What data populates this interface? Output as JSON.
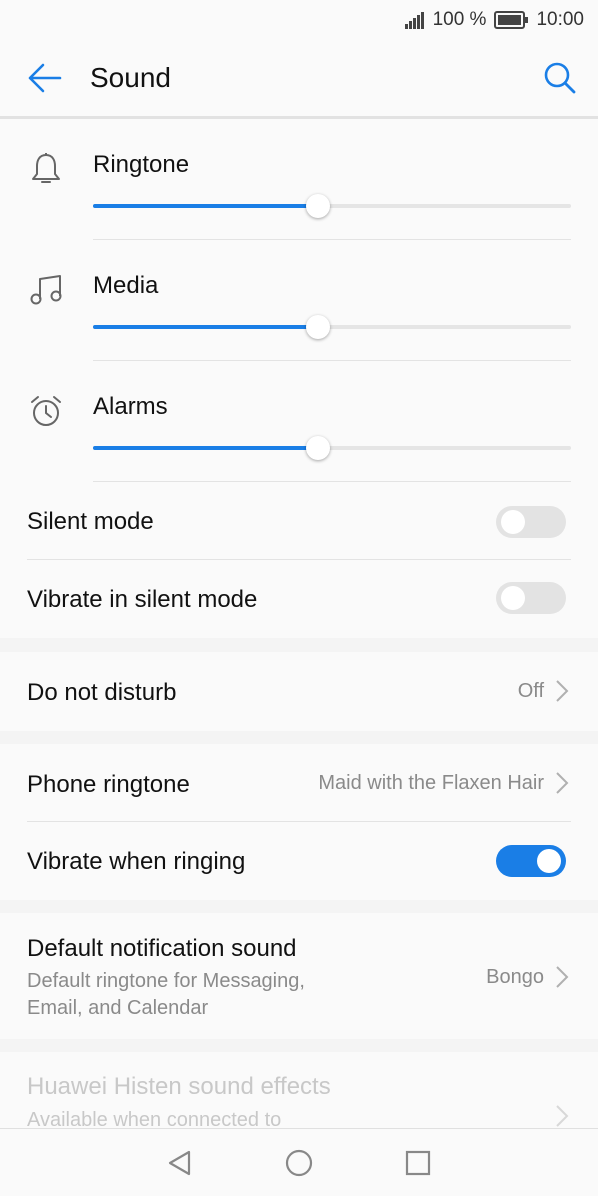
{
  "status_bar": {
    "battery_percent": "100 %",
    "time": "10:00"
  },
  "header": {
    "title": "Sound",
    "back_icon": "arrow-left-icon",
    "search_icon": "search-icon"
  },
  "volumes": [
    {
      "label": "Ringtone",
      "icon": "bell-icon",
      "level": 0.47
    },
    {
      "label": "Media",
      "icon": "music-note-icon",
      "level": 0.47
    },
    {
      "label": "Alarms",
      "icon": "alarm-clock-icon",
      "level": 0.47
    }
  ],
  "silent_mode": {
    "label": "Silent mode",
    "enabled": false
  },
  "vibrate_silent": {
    "label": "Vibrate in silent mode",
    "enabled": false
  },
  "do_not_disturb": {
    "label": "Do not disturb",
    "value": "Off"
  },
  "phone_ringtone": {
    "label": "Phone ringtone",
    "value": "Maid with the Flaxen Hair"
  },
  "vibrate_ringing": {
    "label": "Vibrate when ringing",
    "enabled": true
  },
  "default_notification": {
    "label": "Default notification sound",
    "sublabel_line1": "Default ringtone for Messaging,",
    "sublabel_line2": "Email, and Calendar",
    "value": "Bongo"
  },
  "histen": {
    "label": "Huawei Histen sound effects",
    "sublabel": "Available when connected to"
  },
  "colors": {
    "accent": "#1a7ee6",
    "toggle_off": "#e3e3e3",
    "background": "#f4f4f4",
    "card": "#fafafa"
  }
}
